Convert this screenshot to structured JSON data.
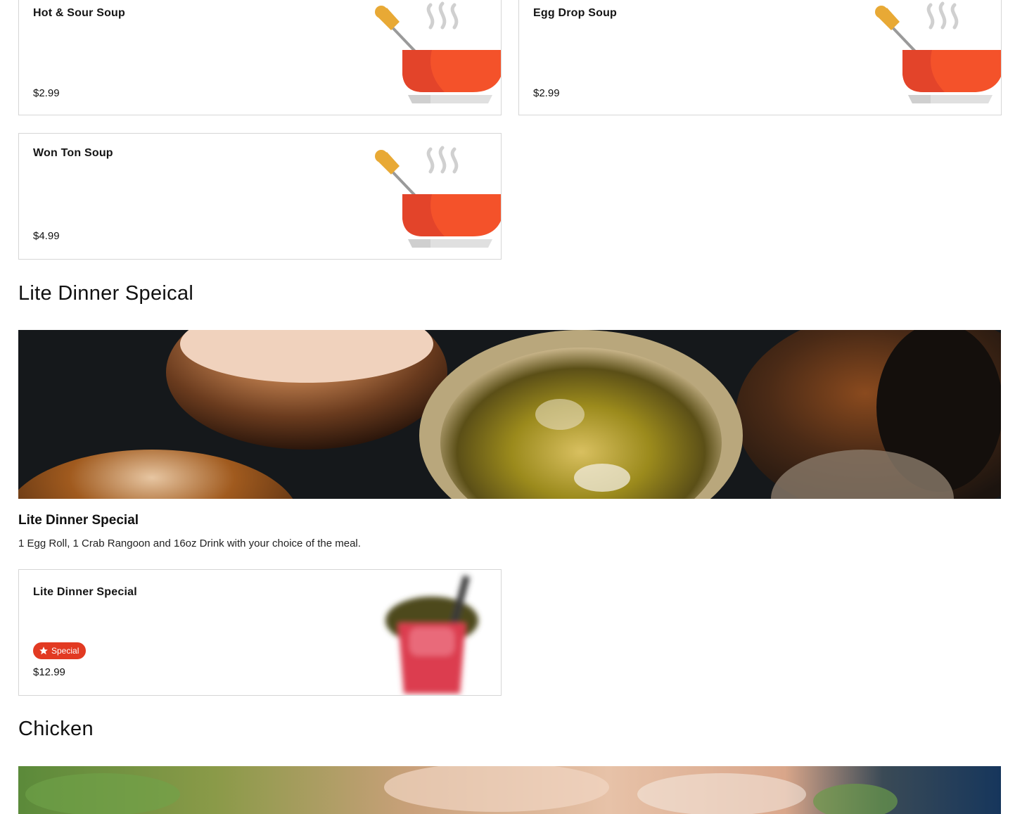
{
  "soups": [
    {
      "name": "Hot & Sour Soup",
      "price": "$2.99",
      "icon": "soup-bowl-icon"
    },
    {
      "name": "Egg Drop Soup",
      "price": "$2.99",
      "icon": "soup-bowl-icon"
    },
    {
      "name": "Won Ton Soup",
      "price": "$4.99",
      "icon": "soup-bowl-icon"
    }
  ],
  "lite_dinner": {
    "section_title": "Lite Dinner Speical",
    "title": "Lite Dinner Special",
    "description": "1 Egg Roll, 1 Crab Rangoon and 16oz Drink with your choice of the meal.",
    "item": {
      "name": "Lite Dinner Special",
      "badge": "Special",
      "price": "$12.99",
      "icon": "takeout-box-icon"
    }
  },
  "chicken": {
    "section_title": "Chicken"
  },
  "colors": {
    "accent": "#e23a22",
    "bowl": "#f4522a",
    "spoon": "#e8a935",
    "border": "#d6d6d6"
  }
}
